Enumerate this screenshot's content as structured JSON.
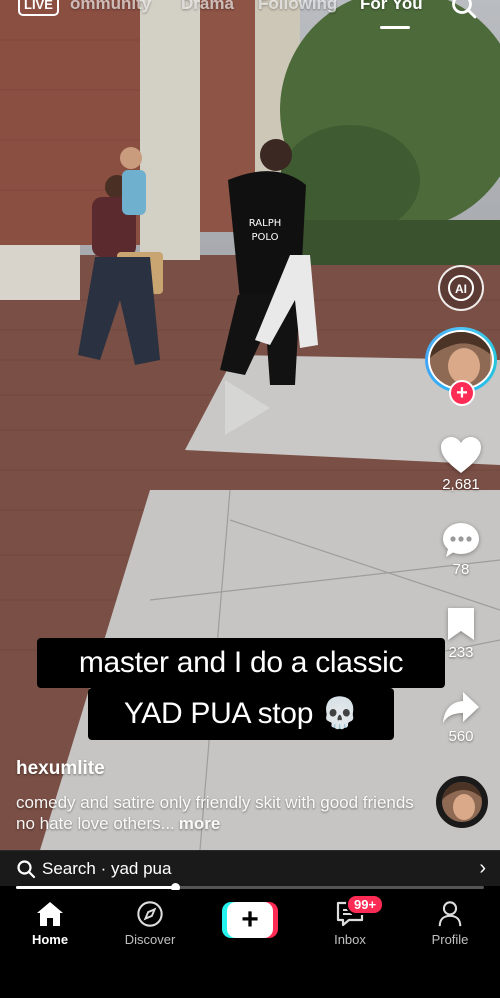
{
  "top_nav": {
    "live_label": "LIVE",
    "tabs": [
      "ommunity",
      "Drama",
      "Following",
      "For You"
    ],
    "active_tab": "For You"
  },
  "right_rail": {
    "likes": "2,681",
    "comments": "78",
    "saves": "233",
    "shares": "560"
  },
  "caption": {
    "line1": "master and I do a classic",
    "line2": "YAD PUA stop 💀"
  },
  "post": {
    "author": "hexumlite",
    "description": "comedy and satire only friendly skit with good friends no hate love others...",
    "more_label": "more"
  },
  "search_strip": {
    "text": "Search · yad pua"
  },
  "playback": {
    "progress_percent": 34
  },
  "bottom_nav": {
    "items": [
      {
        "label": "Home"
      },
      {
        "label": "Discover"
      },
      {
        "label": ""
      },
      {
        "label": "Inbox"
      },
      {
        "label": "Profile"
      }
    ],
    "inbox_badge": "99+"
  },
  "colors": {
    "accent_red": "#fe2c55",
    "accent_cyan": "#25f4ee"
  }
}
